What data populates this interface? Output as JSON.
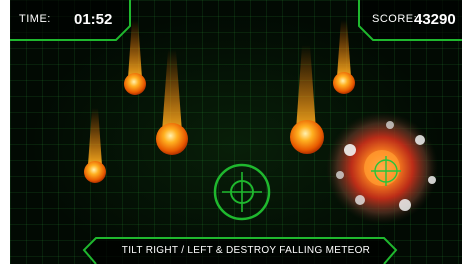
{
  "hud": {
    "time_label": "TIME:",
    "time_value": "01:52",
    "score_label": "SCORE:",
    "score_value": "43290"
  },
  "instruction": "TILT RIGHT / LEFT & DESTROY FALLING METEOR",
  "colors": {
    "hud_green": "#1fb82e",
    "background": "#020a03",
    "meteor_core": "#ffb020",
    "meteor_edge": "#e85a00"
  }
}
